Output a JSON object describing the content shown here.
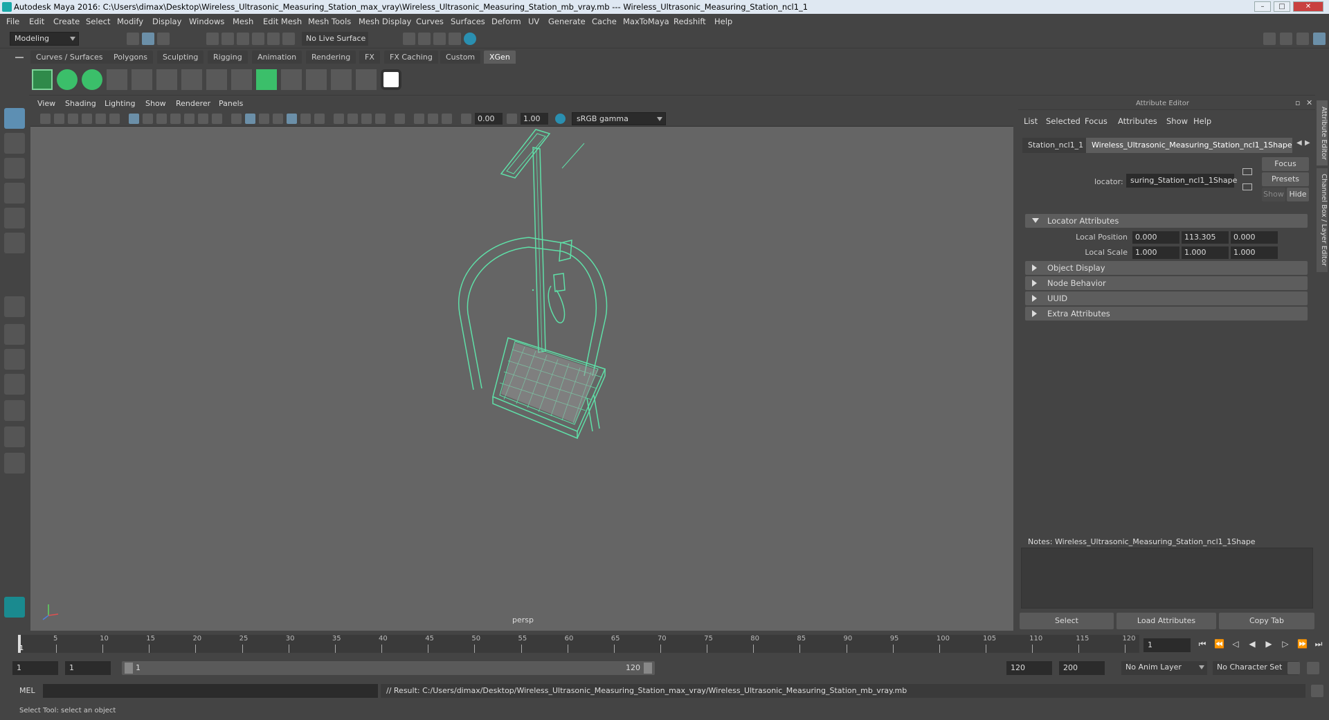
{
  "titlebar": {
    "title": "Autodesk Maya 2016: C:\\Users\\dimax\\Desktop\\Wireless_Ultrasonic_Measuring_Station_max_vray\\Wireless_Ultrasonic_Measuring_Station_mb_vray.mb  ---  Wireless_Ultrasonic_Measuring_Station_ncl1_1",
    "minimize": "–",
    "maximize": "□",
    "close": "✕"
  },
  "menubar": [
    "File",
    "Edit",
    "Create",
    "Select",
    "Modify",
    "Display",
    "Windows",
    "Mesh",
    "Edit Mesh",
    "Mesh Tools",
    "Mesh Display",
    "Curves",
    "Surfaces",
    "Deform",
    "UV",
    "Generate",
    "Cache",
    "MaxToMaya",
    "Redshift",
    "Help"
  ],
  "statusline": {
    "mode": "Modeling",
    "live_surface": "No Live Surface"
  },
  "shelf_tabs": [
    "Curves / Surfaces",
    "Polygons",
    "Sculpting",
    "Rigging",
    "Animation",
    "Rendering",
    "FX",
    "FX Caching",
    "Custom",
    "XGen"
  ],
  "shelf_active_tab": "XGen",
  "viewport": {
    "menus": [
      "View",
      "Shading",
      "Lighting",
      "Show",
      "Renderer",
      "Panels"
    ],
    "exposure": "0.00",
    "gamma": "1.00",
    "color_space": "sRGB gamma",
    "camera_label": "persp"
  },
  "attr_editor": {
    "title": "Attribute Editor",
    "menus": [
      "List",
      "Selected",
      "Focus",
      "Attributes",
      "Show",
      "Help"
    ],
    "tab_left": "Station_ncl1_1",
    "tab_active": "Wireless_Ultrasonic_Measuring_Station_ncl1_1Shape",
    "locator_label": "locator:",
    "locator_value": "suring_Station_ncl1_1Shape",
    "focus_btn": "Focus",
    "presets_btn": "Presets",
    "show_btn": "Show",
    "hide_btn": "Hide",
    "section_locator": "Locator Attributes",
    "local_position_label": "Local Position",
    "local_position": [
      "0.000",
      "113.305",
      "0.000"
    ],
    "local_scale_label": "Local Scale",
    "local_scale": [
      "1.000",
      "1.000",
      "1.000"
    ],
    "sections": [
      "Object Display",
      "Node Behavior",
      "UUID",
      "Extra Attributes"
    ],
    "notes_label": "Notes:  Wireless_Ultrasonic_Measuring_Station_ncl1_1Shape",
    "select_btn": "Select",
    "load_btn": "Load Attributes",
    "copy_btn": "Copy Tab"
  },
  "side_tabs": [
    "Attribute Editor",
    "Channel Box / Layer Editor"
  ],
  "timeline": {
    "ticks": [
      "5",
      "10",
      "15",
      "20",
      "25",
      "30",
      "35",
      "40",
      "45",
      "50",
      "55",
      "60",
      "65",
      "70",
      "75",
      "80",
      "85",
      "90",
      "95",
      "100",
      "105",
      "110",
      "115",
      "120"
    ],
    "current_frame_marker": "1",
    "current_frame": "1"
  },
  "range": {
    "start_frame": "1",
    "range_start": "1",
    "slider_start": "1",
    "slider_end": "120",
    "range_end": "120",
    "end_frame": "200",
    "anim_layer": "No Anim Layer",
    "character_set": "No Character Set"
  },
  "cmdline": {
    "lang": "MEL",
    "result": "// Result: C:/Users/dimax/Desktop/Wireless_Ultrasonic_Measuring_Station_max_vray/Wireless_Ultrasonic_Measuring_Station_mb_vray.mb"
  },
  "helpline": "Select Tool: select an object",
  "colors": {
    "wireframe": "#5fe0a8",
    "xgen_green": "#3bbf6a"
  }
}
